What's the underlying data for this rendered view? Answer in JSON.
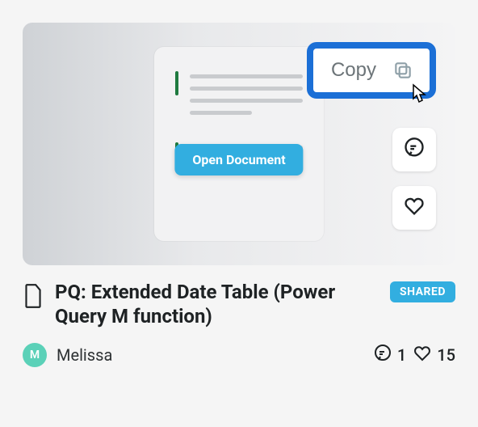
{
  "card": {
    "copy_label": "Copy",
    "open_label": "Open Document",
    "title": "PQ: Extended Date Table (Power Query M function)",
    "badge": "SHARED",
    "author": {
      "name": "Melissa",
      "initial": "M"
    },
    "stats": {
      "comments": "1",
      "likes": "15"
    }
  },
  "colors": {
    "accent": "#32aee0",
    "highlight_border": "#1b6fd6",
    "doc_bullet": "#1f7a3f"
  }
}
